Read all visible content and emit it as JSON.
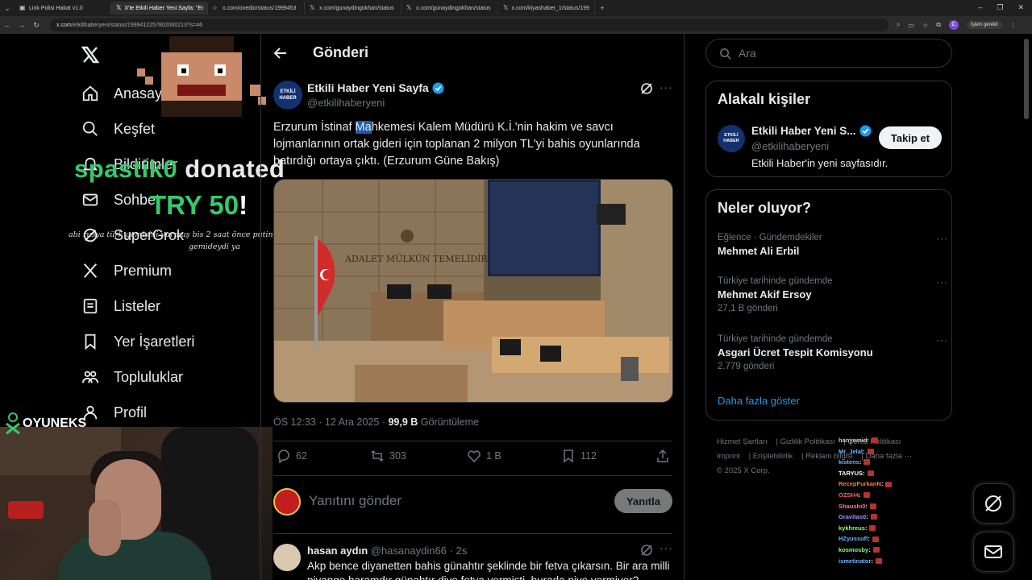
{
  "browser": {
    "tabs": [
      {
        "label": "Link Polisi Hakat v1.0",
        "active": false
      },
      {
        "label": "X'te Etkili Haber Yeni Sayfa: \"Er",
        "active": true
      },
      {
        "label": "x.com/onedio/status/1999453",
        "active": false
      },
      {
        "label": "x.com/gunaydingokhan/status",
        "active": false
      },
      {
        "label": "x.com/gunaydingokhan/status",
        "active": false
      },
      {
        "label": "x.com/kiyashaber_1/status/199",
        "active": false
      }
    ],
    "url_domain": "x.com",
    "url_path": "/etkilihaberyeni/status/1999412257802060213?s=46",
    "profile_initial": "C",
    "paused_label": "İşlem gerekli"
  },
  "nav": {
    "items": [
      {
        "label": "Anasayfa",
        "icon": "home-icon"
      },
      {
        "label": "Keşfet",
        "icon": "search-icon"
      },
      {
        "label": "Bildirimler",
        "icon": "bell-icon"
      },
      {
        "label": "Sohbet",
        "icon": "mail-icon"
      },
      {
        "label": "SuperGrok",
        "icon": "grok-icon"
      },
      {
        "label": "Premium",
        "icon": "x-icon"
      },
      {
        "label": "Listeler",
        "icon": "list-icon"
      },
      {
        "label": "Yer İşaretleri",
        "icon": "bookmark-icon"
      },
      {
        "label": "Topluluklar",
        "icon": "people-icon"
      },
      {
        "label": "Profil",
        "icon": "user-icon"
      }
    ]
  },
  "overlay": {
    "donor": "spastik0",
    "donated": "donated",
    "amount": "TRY 50",
    "exclaim": "!",
    "message": "abi rusya türk gemisini vurmuş bis 2 saat önce putinle el sıkışmıştı pelerde gemideydi ya",
    "brand": "OYUNEKS"
  },
  "post": {
    "header_title": "Gönderi",
    "author_name": "Etkili Haber Yeni Sayfa",
    "author_handle": "@etkilihaberyeni",
    "avatar_line1": "ETKİLİ",
    "avatar_line2": "HABER",
    "text_before": "Erzurum İstinaf ",
    "text_highlight": "Ma",
    "text_after": "hkemesi Kalem Müdürü K.İ.'nin hakim ve savcı lojmanlarının ortak gideri için toplanan 2 milyon TL'yi bahis oyunlarında batırdığı ortaya çıktı. (Erzurum Güne Bakış)",
    "photo_sign": "ADALET MÜLKÜN TEMELİDİR",
    "timestamp": "ÖS 12:33 · 12 Ara 2025 · ",
    "views_count": "99,9 B",
    "views_label": " Görüntüleme",
    "replies": "62",
    "reposts": "303",
    "likes": "1 B",
    "bookmarks": "112",
    "reply_placeholder": "Yanıtını gönder",
    "reply_button": "Yanıtla"
  },
  "comment": {
    "name": "hasan aydın",
    "meta": " @hasanaydin66 · 2s",
    "text": "Akp bence diyanetten bahis günahtır şeklinde bir fetva çıkarsın. Bir ara milli piyango haramdır günahtır diye fetva vermişti, burada niye vermiyor?"
  },
  "sidebar": {
    "search_placeholder": "Ara",
    "related_title": "Alakalı kişiler",
    "related_name": "Etkili Haber Yeni S...",
    "related_handle": "@etkilihaberyeni",
    "related_bio": "Etkili Haber'in yeni sayfasıdır.",
    "follow_label": "Takip et",
    "trends_title": "Neler oluyor?",
    "trends": [
      {
        "context": "Eğlence · Gündemdekiler",
        "name": "Mehmet Ali Erbil",
        "count": ""
      },
      {
        "context": "Türkiye tarihinde gündemde",
        "name": "Mehmet Akif Ersoy",
        "count": "27,1 B gönderi"
      },
      {
        "context": "Türkiye tarihinde gündemde",
        "name": "Asgari Ücret Tespit Komisyonu",
        "count": "2.779 gönderi"
      }
    ],
    "show_more": "Daha fazla göster",
    "footer_links": [
      "Hizmet Şartları",
      "Gizlilik Politikası",
      "Çerez Politikası",
      "Imprint",
      "Erişilebilirlik",
      "Reklam bilgisi",
      "Daha fazla ···"
    ],
    "copyright": "© 2025 X Corp."
  },
  "chat": [
    {
      "user": "hanyomid",
      "msg": "",
      "color": "#c9c9c9"
    },
    {
      "user": "Mr_Jelal",
      "msg": "",
      "color": "#6fb3ff"
    },
    {
      "user": "kistens",
      "msg": "",
      "color": "#6fb3ff"
    },
    {
      "user": "TARYUS",
      "msg": "",
      "color": "#ffffff"
    },
    {
      "user": "RecepFurkanN",
      "msg": "",
      "color": "#ff7b3a"
    },
    {
      "user": "OZSH4",
      "msg": "",
      "color": "#ff5f5f"
    },
    {
      "user": "Shaushi0",
      "msg": "",
      "color": "#ff6fa8"
    },
    {
      "user": "Gravitas0",
      "msg": "",
      "color": "#b38cff"
    },
    {
      "user": "kykhreus",
      "msg": "",
      "color": "#8cff6a"
    },
    {
      "user": "HZyussufl",
      "msg": "",
      "color": "#6fb3ff"
    },
    {
      "user": "kosmosby",
      "msg": "",
      "color": "#8cff6a"
    },
    {
      "user": "ismetinator",
      "msg": "",
      "color": "#6fb3ff"
    }
  ],
  "colors": {
    "accent": "#1d9bf0",
    "donor": "#37c86b",
    "background": "#000000"
  }
}
